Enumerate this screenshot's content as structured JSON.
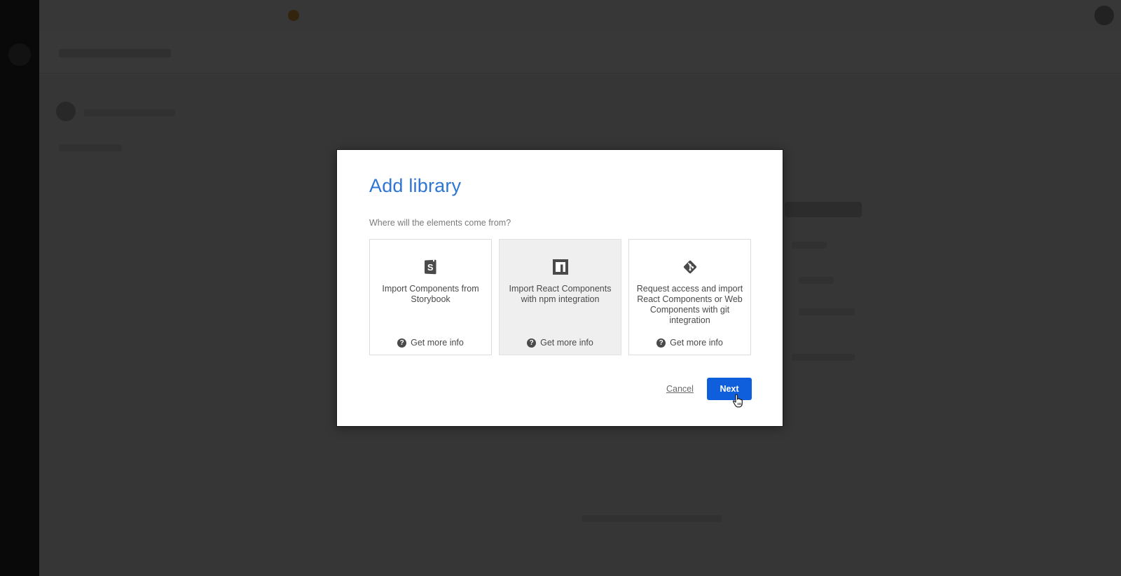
{
  "modal": {
    "title": "Add library",
    "question": "Where will the elements come from?",
    "cards": [
      {
        "icon": "storybook-icon",
        "text": "Import Components from Storybook",
        "info_label": "Get more info",
        "hovered": false
      },
      {
        "icon": "npm-icon",
        "text": "Import React Components with npm integration",
        "info_label": "Get more info",
        "hovered": true
      },
      {
        "icon": "git-icon",
        "text": "Request access and import React Components or Web Components with git integration",
        "info_label": "Get more info",
        "hovered": false
      }
    ],
    "cancel_label": "Cancel",
    "next_label": "Next"
  },
  "colors": {
    "title": "#2f76d2",
    "primary_button": "#0f5fdc",
    "overlay": "rgba(0,0,0,0.78)"
  }
}
